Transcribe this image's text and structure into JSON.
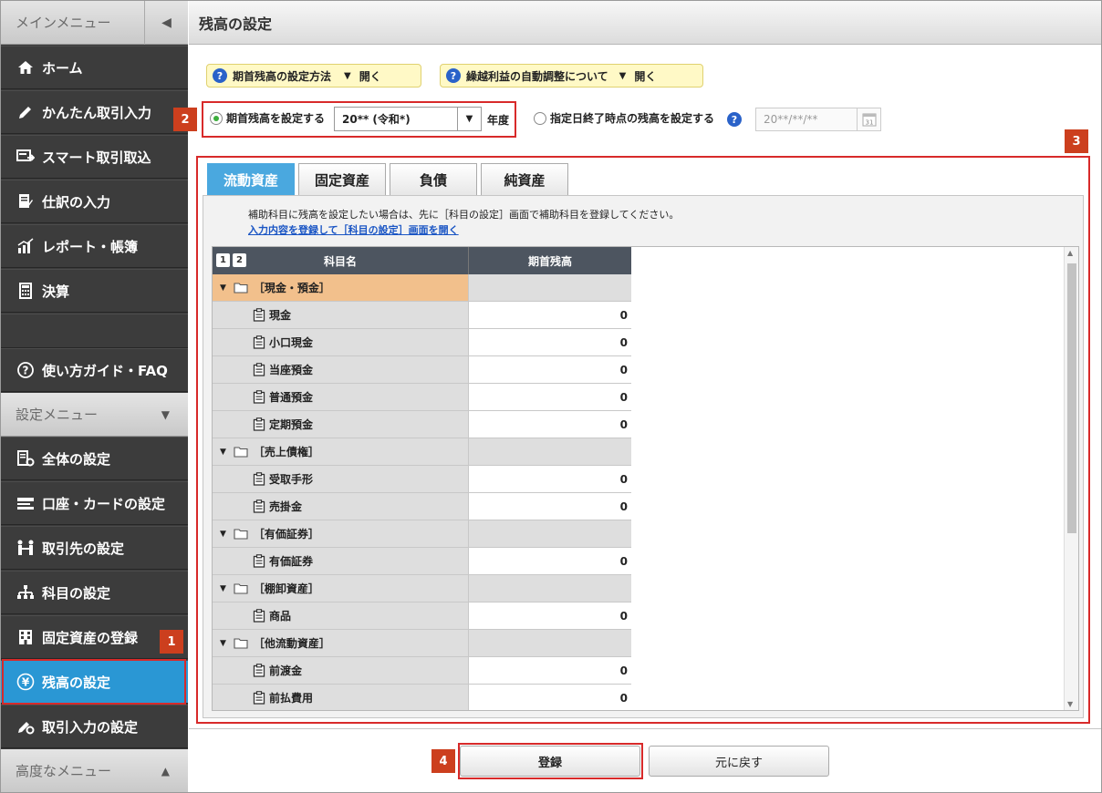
{
  "sidebar": {
    "main_menu_label": "メインメニュー",
    "main_items": [
      {
        "label": "ホーム",
        "icon": "home-icon"
      },
      {
        "label": "かんたん取引入力",
        "icon": "pencil-icon"
      },
      {
        "label": "スマート取引取込",
        "icon": "import-icon"
      },
      {
        "label": "仕訳の入力",
        "icon": "journal-icon"
      },
      {
        "label": "レポート・帳簿",
        "icon": "report-icon"
      },
      {
        "label": "決算",
        "icon": "calculator-icon"
      }
    ],
    "guide_label": "使い方ガイド・FAQ",
    "settings_menu_label": "設定メニュー",
    "settings_items": [
      {
        "label": "全体の設定",
        "icon": "settings-doc-icon"
      },
      {
        "label": "口座・カードの設定",
        "icon": "card-icon"
      },
      {
        "label": "取引先の設定",
        "icon": "partner-icon"
      },
      {
        "label": "科目の設定",
        "icon": "account-tree-icon"
      },
      {
        "label": "固定資産の登録",
        "icon": "building-icon"
      },
      {
        "label": "残高の設定",
        "icon": "yen-icon"
      },
      {
        "label": "取引入力の設定",
        "icon": "input-settings-icon"
      }
    ],
    "advanced_menu_label": "高度なメニュー"
  },
  "header": {
    "title": "残高の設定"
  },
  "help": {
    "pill1": "期首残高の設定方法",
    "pill2": "繰越利益の自動調整について",
    "open_label": "開く"
  },
  "options": {
    "radio1_label": "期首残高を設定する",
    "year_value": "20** (令和*)",
    "year_suffix": "年度",
    "radio2_label": "指定日終了時点の残高を設定する",
    "date_placeholder": "20**/**/**"
  },
  "badges": [
    "1",
    "2",
    "3",
    "4"
  ],
  "tabs": [
    "流動資産",
    "固定資産",
    "負債",
    "純資産"
  ],
  "notice": {
    "text": "補助科目に残高を設定したい場合は、先に［科目の設定］画面で補助科目を登録してください。",
    "link": "入力内容を登録して［科目の設定］画面を開く"
  },
  "table": {
    "levels": [
      "1",
      "2"
    ],
    "col_name": "科目名",
    "col_balance": "期首残高",
    "rows": [
      {
        "type": "group",
        "name": "［現金・預金］",
        "selected": true
      },
      {
        "type": "item",
        "name": "現金",
        "value": "0"
      },
      {
        "type": "item",
        "name": "小口現金",
        "value": "0"
      },
      {
        "type": "item",
        "name": "当座預金",
        "value": "0"
      },
      {
        "type": "item",
        "name": "普通預金",
        "value": "0"
      },
      {
        "type": "item",
        "name": "定期預金",
        "value": "0"
      },
      {
        "type": "group",
        "name": "［売上債権］"
      },
      {
        "type": "item",
        "name": "受取手形",
        "value": "0"
      },
      {
        "type": "item",
        "name": "売掛金",
        "value": "0"
      },
      {
        "type": "group",
        "name": "［有価証券］"
      },
      {
        "type": "item",
        "name": "有価証券",
        "value": "0"
      },
      {
        "type": "group",
        "name": "［棚卸資産］"
      },
      {
        "type": "item",
        "name": "商品",
        "value": "0"
      },
      {
        "type": "group",
        "name": "［他流動資産］"
      },
      {
        "type": "item",
        "name": "前渡金",
        "value": "0"
      },
      {
        "type": "item",
        "name": "前払費用",
        "value": "0"
      }
    ]
  },
  "footer": {
    "register_label": "登録",
    "back_label": "元に戻す"
  },
  "colors": {
    "active": "#2a97d4",
    "badge": "#cc3f1e",
    "highlight": "#d82a2a",
    "selected_row": "#f2c08c"
  }
}
